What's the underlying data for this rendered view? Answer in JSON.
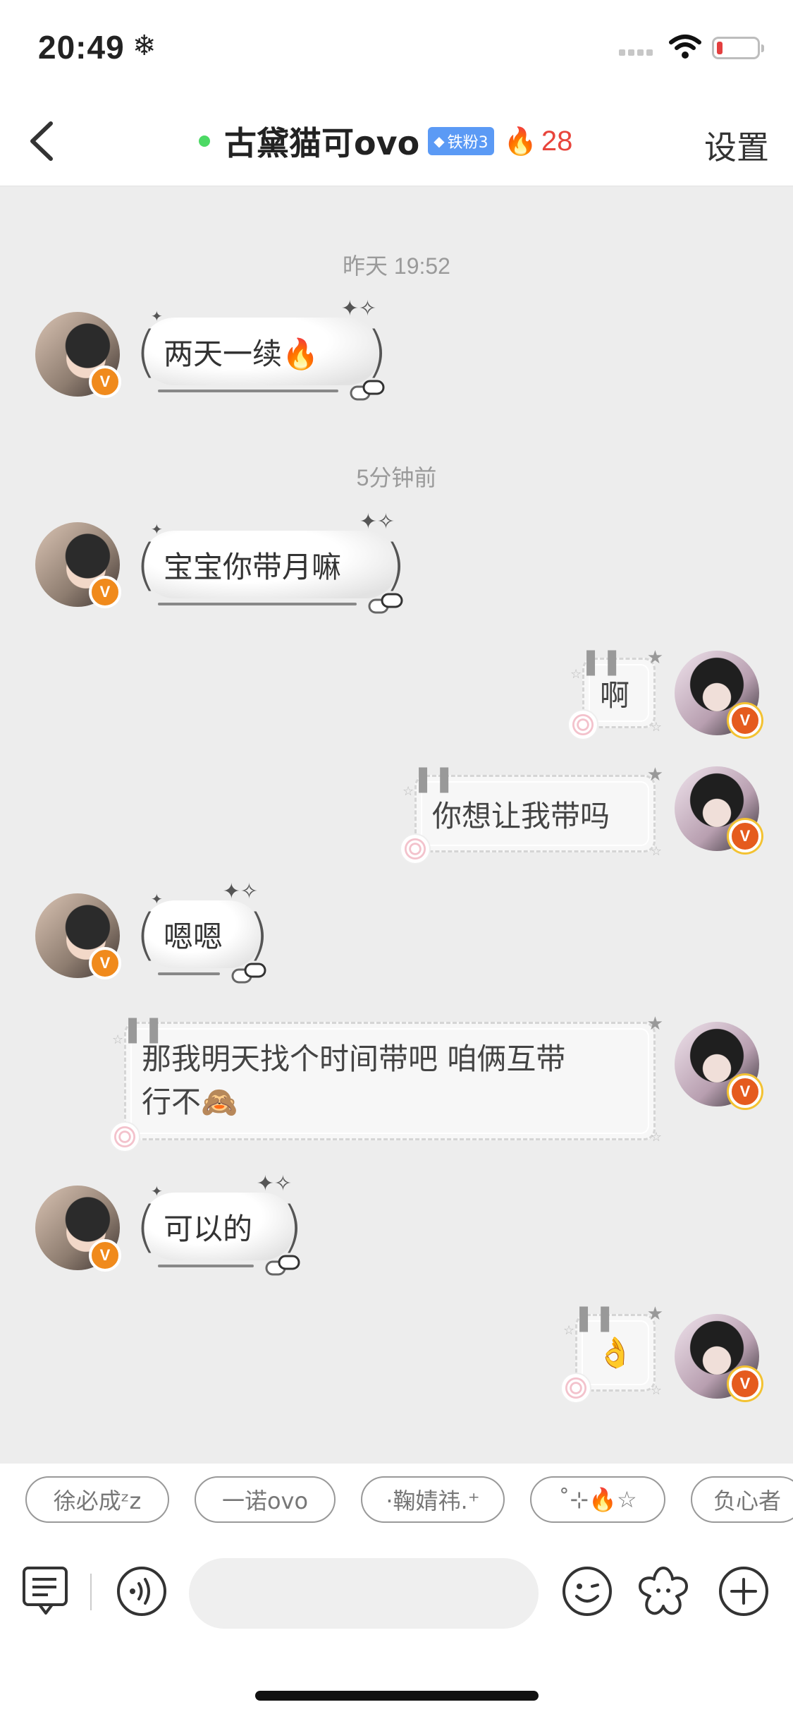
{
  "status_bar": {
    "time": "20:49",
    "snow": "❄"
  },
  "nav": {
    "title": "古黛猫可ovo",
    "fan_badge": "铁粉3",
    "fire_count": "28",
    "settings": "设置"
  },
  "timestamps": {
    "t1": "昨天 19:52",
    "t2": "5分钟前"
  },
  "messages": {
    "m1": "两天一续🔥",
    "m2": "宝宝你带月嘛",
    "m3": "啊",
    "m4": "你想让我带吗",
    "m5": "嗯嗯",
    "m6a": "那我明天找个时间带吧 咱俩互带",
    "m6b": "行不🙈",
    "m7": "可以的",
    "m8": "👌"
  },
  "badges": {
    "v": "V"
  },
  "quick_replies": [
    "徐必成ᶻz",
    "一诺ovo",
    "·鞠婧祎.⁺",
    "˚⊹🔥☆",
    "负心者"
  ],
  "input": {
    "placeholder": ""
  }
}
